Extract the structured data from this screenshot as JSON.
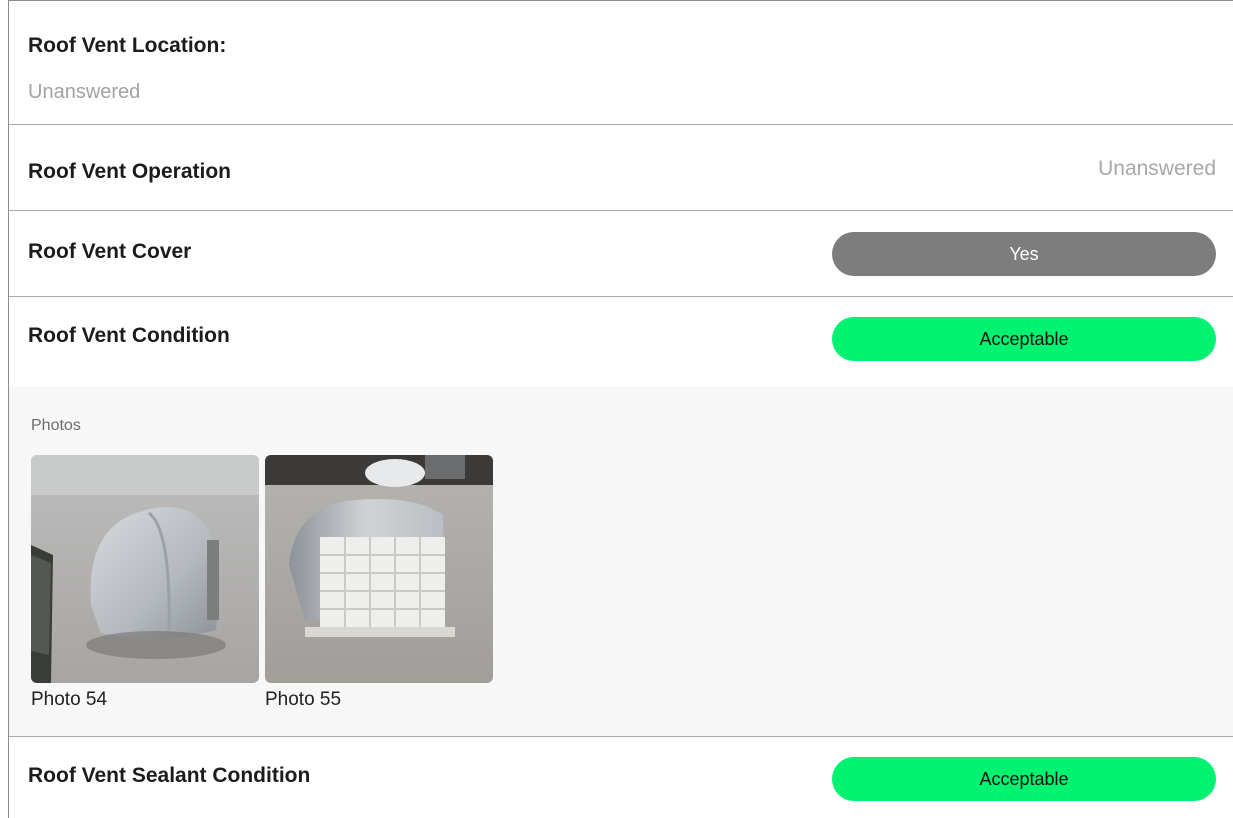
{
  "items": {
    "location": {
      "label": "Roof Vent Location:",
      "value": "Unanswered"
    },
    "operation": {
      "label": "Roof Vent Operation",
      "value": "Unanswered"
    },
    "cover": {
      "label": "Roof Vent Cover",
      "value": "Yes",
      "color": "#7d7d7d"
    },
    "condition": {
      "label": "Roof Vent Condition",
      "value": "Acceptable",
      "color": "#00f271",
      "photos": {
        "title": "Photos",
        "list": [
          {
            "caption": "Photo 54",
            "icon": "roof-vent-cover-photo"
          },
          {
            "caption": "Photo 55",
            "icon": "roof-vent-cover-photo"
          }
        ]
      }
    },
    "sealant": {
      "label": "Roof Vent Sealant Condition",
      "value": "Acceptable",
      "color": "#00f271"
    }
  }
}
